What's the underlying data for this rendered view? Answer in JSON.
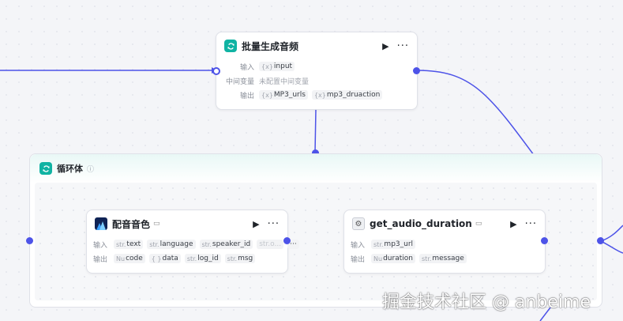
{
  "batch_node": {
    "title": "批量生成音频",
    "input_label": "输入",
    "inputs": [
      {
        "type": "{x}",
        "name": "input"
      }
    ],
    "intermediate_label": "中间变量",
    "intermediate_value": "未配置中间变量",
    "output_label": "输出",
    "outputs": [
      {
        "type": "{x}",
        "name": "MP3_urls"
      },
      {
        "type": "{x}",
        "name": "mp3_druaction"
      }
    ]
  },
  "loop": {
    "title": "循环体"
  },
  "voice_node": {
    "title": "配音音色",
    "input_label": "输入",
    "inputs": [
      {
        "type": "str.",
        "name": "text"
      },
      {
        "type": "str.",
        "name": "language"
      },
      {
        "type": "str.",
        "name": "speaker_id"
      },
      {
        "type": "",
        "name": "str.o..."
      }
    ],
    "more_tag": "···",
    "output_label": "输出",
    "outputs": [
      {
        "type": "Nu",
        "name": "code"
      },
      {
        "type": "{ }",
        "name": "data"
      },
      {
        "type": "str.",
        "name": "log_id"
      },
      {
        "type": "str.",
        "name": "msg"
      }
    ]
  },
  "duration_node": {
    "title": "get_audio_duration",
    "input_label": "输入",
    "inputs": [
      {
        "type": "str.",
        "name": "mp3_url"
      }
    ],
    "output_label": "输出",
    "outputs": [
      {
        "type": "Nu",
        "name": "duration"
      },
      {
        "type": "str.",
        "name": "message"
      }
    ]
  },
  "watermark": "掘金技术社区 @ anbeime",
  "colors": {
    "edge": "#4d53e8",
    "loop_icon": "#10b3a3"
  }
}
